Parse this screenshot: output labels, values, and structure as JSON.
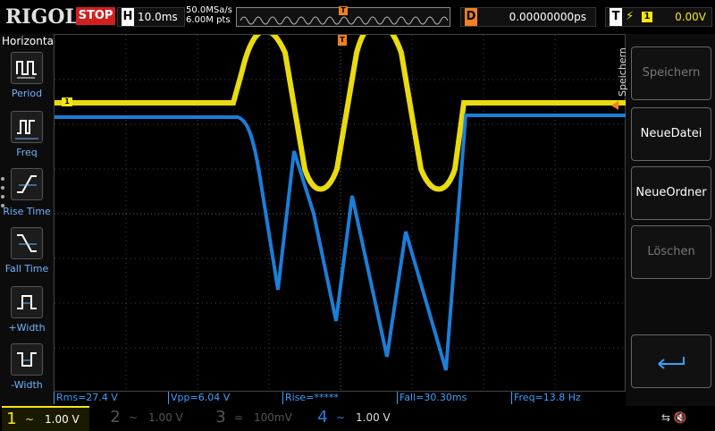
{
  "header": {
    "logo": "RIGOL",
    "run_state": "STOP",
    "timebase_key": "H",
    "timebase": "10.0ms",
    "sample_rate": "50.0MSa/s",
    "memory_depth": "6.00M pts",
    "trigger_pos_marker": "T",
    "delay_key": "D",
    "delay": "0.00000000ps",
    "trigger_key": "T",
    "trigger_source": "1",
    "trigger_level": "0.00V"
  },
  "left_menu": {
    "title": "Horizontal",
    "items": [
      {
        "label": "Period"
      },
      {
        "label": "Freq"
      },
      {
        "label": "Rise Time"
      },
      {
        "label": "Fall Time"
      },
      {
        "label": "+Width"
      },
      {
        "label": "-Width"
      }
    ]
  },
  "right_menu": {
    "title": "Speichern",
    "buttons": [
      {
        "label": "Speichern",
        "enabled": false
      },
      {
        "label": "NeueDatei",
        "enabled": true
      },
      {
        "label": "NeueOrdner",
        "enabled": true
      },
      {
        "label": "Löschen",
        "enabled": false
      }
    ]
  },
  "screen": {
    "ch1_marker": "1",
    "trigger_marker": "T",
    "ch2_marker_hidden": ""
  },
  "measurements": [
    {
      "label": "Rms=27.4 V"
    },
    {
      "label": "Vpp=6.04 V"
    },
    {
      "label": "Rise=*****"
    },
    {
      "label": "Fall=30.30ms"
    },
    {
      "label": "Freq=13.8 Hz"
    }
  ],
  "channels": [
    {
      "num": "1",
      "coupling": "~",
      "scale": "1.00 V",
      "active": true,
      "color": "#f5e70f"
    },
    {
      "num": "2",
      "coupling": "~",
      "scale": "1.00 V",
      "active": false,
      "color": "#27b1e8"
    },
    {
      "num": "3",
      "coupling": "=",
      "scale": "100mV",
      "active": false,
      "color": "#d62aa6"
    },
    {
      "num": "4",
      "coupling": "~",
      "scale": "1.00 V",
      "active": false,
      "color": "#2a7de1"
    }
  ],
  "colors": {
    "ch1": "#f5e70f",
    "ch2": "#1e8cf0",
    "accent": "#f08020",
    "stop": "#d21f1f"
  }
}
